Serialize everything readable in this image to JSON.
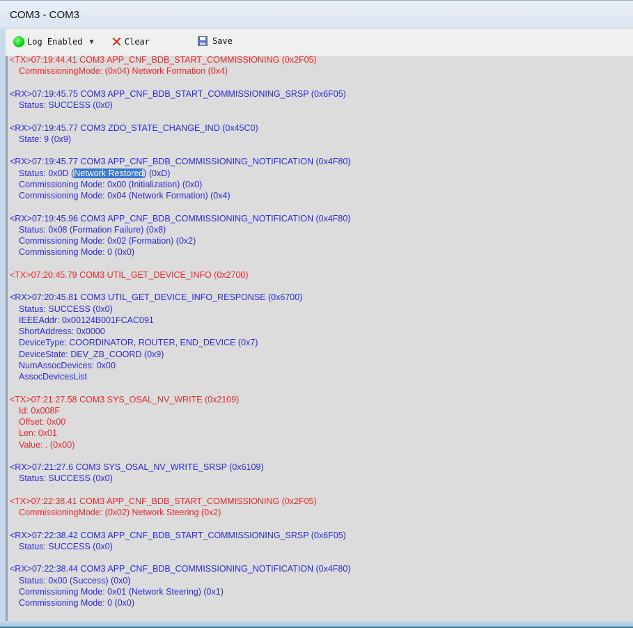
{
  "window": {
    "title": "COM3 - COM3"
  },
  "toolbar": {
    "log_enabled_label": "Log Enabled",
    "clear_label": "Clear",
    "save_label": "Save",
    "log_status_color": "#10d010"
  },
  "colors": {
    "tx": "#f02828",
    "rx": "#2a2ae0",
    "selection": "#3b78d0"
  },
  "log": [
    {
      "type": "tx",
      "text": "<TX>07:19:44.41 COM3 APP_CNF_BDB_START_COMMISSIONING (0x2F05)"
    },
    {
      "type": "tx",
      "indent": true,
      "text": "CommissioningMode: (0x04) Network Formation (0x4)"
    },
    {
      "type": "blank",
      "text": ""
    },
    {
      "type": "rx",
      "text": "<RX>07:19:45.75 COM3 APP_CNF_BDB_START_COMMISSIONING_SRSP (0x6F05)"
    },
    {
      "type": "rx",
      "indent": true,
      "text": "Status: SUCCESS (0x0)"
    },
    {
      "type": "blank",
      "text": ""
    },
    {
      "type": "rx",
      "text": "<RX>07:19:45.77 COM3 ZDO_STATE_CHANGE_IND (0x45C0)"
    },
    {
      "type": "rx",
      "indent": true,
      "text": "State: 9 (0x9)"
    },
    {
      "type": "blank",
      "text": ""
    },
    {
      "type": "rx",
      "text": "<RX>07:19:45.77 COM3 APP_CNF_BDB_COMMISSIONING_NOTIFICATION (0x4F80)"
    },
    {
      "type": "rx",
      "indent": true,
      "text": "Status: 0x0D (Network Restored) (0xD)",
      "highlight": "Network Restored"
    },
    {
      "type": "rx",
      "indent": true,
      "text": "Commissioning Mode: 0x00 (Initialization) (0x0)"
    },
    {
      "type": "rx",
      "indent": true,
      "text": "Commissioning Mode: 0x04 (Network Formation) (0x4)"
    },
    {
      "type": "blank",
      "text": ""
    },
    {
      "type": "rx",
      "text": "<RX>07:19:45.96 COM3 APP_CNF_BDB_COMMISSIONING_NOTIFICATION (0x4F80)"
    },
    {
      "type": "rx",
      "indent": true,
      "text": "Status: 0x08 (Formation Failure) (0x8)"
    },
    {
      "type": "rx",
      "indent": true,
      "text": "Commissioning Mode: 0x02 (Formation) (0x2)"
    },
    {
      "type": "rx",
      "indent": true,
      "text": "Commissioning Mode: 0 (0x0)"
    },
    {
      "type": "blank",
      "text": ""
    },
    {
      "type": "tx",
      "text": "<TX>07:20:45.79 COM3 UTIL_GET_DEVICE_INFO (0x2700)"
    },
    {
      "type": "blank",
      "text": ""
    },
    {
      "type": "rx",
      "text": "<RX>07:20:45.81 COM3 UTIL_GET_DEVICE_INFO_RESPONSE (0x6700)"
    },
    {
      "type": "rx",
      "indent": true,
      "text": "Status: SUCCESS (0x0)"
    },
    {
      "type": "rx",
      "indent": true,
      "text": "IEEEAddr: 0x00124B001FCAC091"
    },
    {
      "type": "rx",
      "indent": true,
      "text": "ShortAddress: 0x0000"
    },
    {
      "type": "rx",
      "indent": true,
      "text": "DeviceType: COORDINATOR, ROUTER, END_DEVICE (0x7)"
    },
    {
      "type": "rx",
      "indent": true,
      "text": "DeviceState: DEV_ZB_COORD (0x9)"
    },
    {
      "type": "rx",
      "indent": true,
      "text": "NumAssocDevices: 0x00"
    },
    {
      "type": "rx",
      "indent": true,
      "text": "AssocDevicesList"
    },
    {
      "type": "blank",
      "text": ""
    },
    {
      "type": "tx",
      "text": "<TX>07:21:27.58 COM3 SYS_OSAL_NV_WRITE (0x2109)"
    },
    {
      "type": "tx",
      "indent": true,
      "text": "Id: 0x008F"
    },
    {
      "type": "tx",
      "indent": true,
      "text": "Offset: 0x00"
    },
    {
      "type": "tx",
      "indent": true,
      "text": "Len: 0x01"
    },
    {
      "type": "tx",
      "indent": true,
      "text": "Value: . (0x00)"
    },
    {
      "type": "blank",
      "text": ""
    },
    {
      "type": "rx",
      "text": "<RX>07:21:27.6 COM3 SYS_OSAL_NV_WRITE_SRSP (0x6109)"
    },
    {
      "type": "rx",
      "indent": true,
      "text": "Status: SUCCESS (0x0)"
    },
    {
      "type": "blank",
      "text": ""
    },
    {
      "type": "tx",
      "text": "<TX>07:22:38.41 COM3 APP_CNF_BDB_START_COMMISSIONING (0x2F05)"
    },
    {
      "type": "tx",
      "indent": true,
      "text": "CommissioningMode: (0x02) Network Steering (0x2)"
    },
    {
      "type": "blank",
      "text": ""
    },
    {
      "type": "rx",
      "text": "<RX>07:22:38.42 COM3 APP_CNF_BDB_START_COMMISSIONING_SRSP (0x6F05)"
    },
    {
      "type": "rx",
      "indent": true,
      "text": "Status: SUCCESS (0x0)"
    },
    {
      "type": "blank",
      "text": ""
    },
    {
      "type": "rx",
      "text": "<RX>07:22:38.44 COM3 APP_CNF_BDB_COMMISSIONING_NOTIFICATION (0x4F80)"
    },
    {
      "type": "rx",
      "indent": true,
      "text": "Status: 0x00 (Success) (0x0)"
    },
    {
      "type": "rx",
      "indent": true,
      "text": "Commissioning Mode: 0x01 (Network Steering) (0x1)"
    },
    {
      "type": "rx",
      "indent": true,
      "text": "Commissioning Mode: 0 (0x0)"
    }
  ]
}
